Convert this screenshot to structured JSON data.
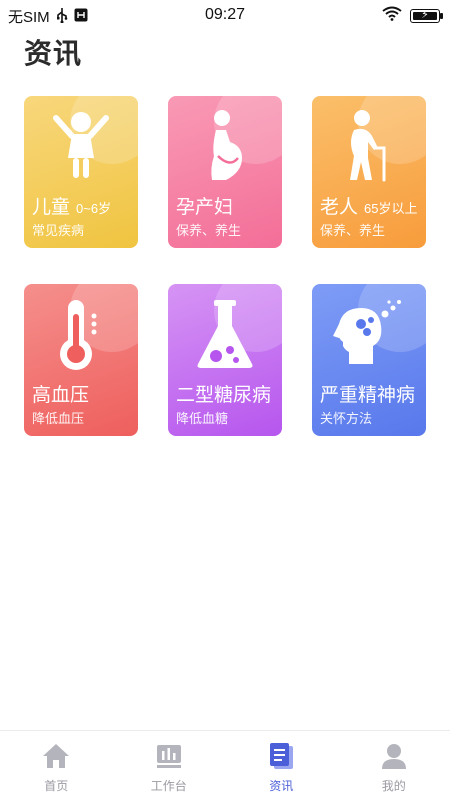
{
  "status_bar": {
    "carrier": "无SIM",
    "time": "09:27"
  },
  "page_title": "资讯",
  "cards": [
    {
      "title": "儿童",
      "age": "0~6岁",
      "subtitle": "常见疾病",
      "icon": "child-icon"
    },
    {
      "title": "孕产妇",
      "age": "",
      "subtitle": "保养、养生",
      "icon": "pregnant-woman-icon"
    },
    {
      "title": "老人",
      "age": "65岁以上",
      "subtitle": "保养、养生",
      "icon": "elderly-icon"
    },
    {
      "title": "高血压",
      "age": "",
      "subtitle": "降低血压",
      "icon": "thermometer-icon"
    },
    {
      "title": "二型糖尿病",
      "age": "",
      "subtitle": "降低血糖",
      "icon": "flask-icon"
    },
    {
      "title": "严重精神病",
      "age": "",
      "subtitle": "关怀方法",
      "icon": "head-bubbles-icon"
    }
  ],
  "tabbar": {
    "active_index": 2,
    "active_color": "#4a5fd8",
    "inactive_color": "#9a9aa2",
    "items": [
      {
        "label": "首页",
        "icon": "home-icon"
      },
      {
        "label": "工作台",
        "icon": "workbench-icon"
      },
      {
        "label": "资讯",
        "icon": "news-icon"
      },
      {
        "label": "我的",
        "icon": "user-icon"
      }
    ]
  }
}
